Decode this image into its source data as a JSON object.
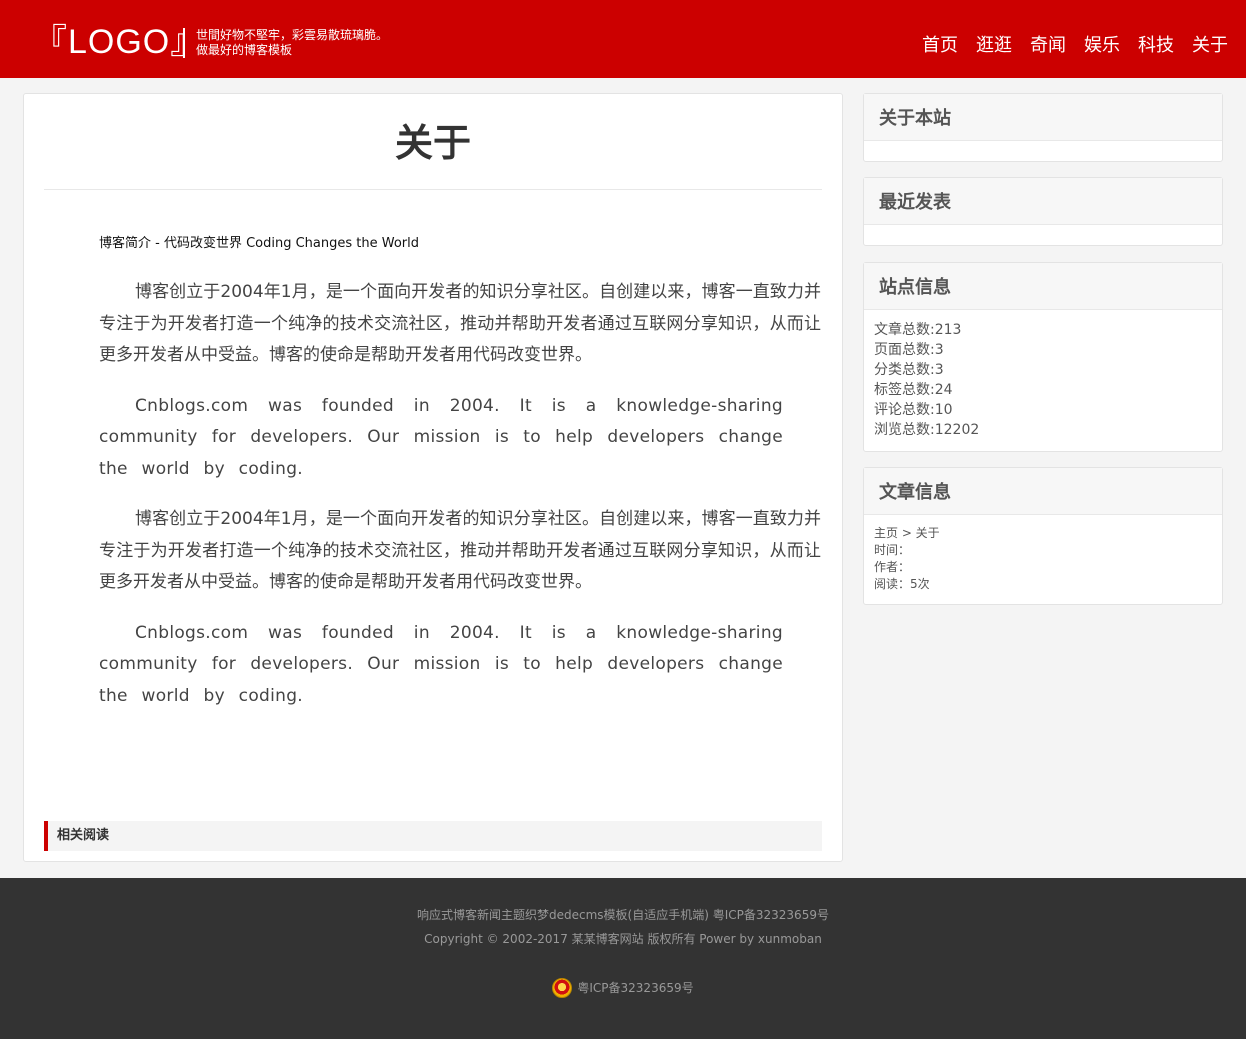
{
  "header": {
    "logo": "『LOGO』",
    "tagline": [
      "世間好物不堅牢，彩雲易散琉璃脆。",
      "做最好的博客模板"
    ],
    "nav": [
      "首页",
      "逛逛",
      "奇闻",
      "娱乐",
      "科技",
      "关于"
    ]
  },
  "article": {
    "title": "关于",
    "intro": "博客简介 - 代码改变世界 Coding Changes the World",
    "paragraphs": [
      "博客创立于2004年1月，是一个面向开发者的知识分享社区。自创建以来，博客一直致力并专注于为开发者打造一个纯净的技术交流社区，推动并帮助开发者通过互联网分享知识，从而让更多开发者从中受益。博客的使命是帮助开发者用代码改变世界。",
      "Cnblogs.com was founded in 2004. It is a knowledge-sharing community for developers. Our mission is to help developers change the world by coding.",
      "博客创立于2004年1月，是一个面向开发者的知识分享社区。自创建以来，博客一直致力并专注于为开发者打造一个纯净的技术交流社区，推动并帮助开发者通过互联网分享知识，从而让更多开发者从中受益。博客的使命是帮助开发者用代码改变世界。",
      "Cnblogs.com was founded in 2004. It is a knowledge-sharing community for developers. Our mission is to help developers change the world by coding."
    ],
    "related_label": "相关阅读"
  },
  "sidebar": {
    "about_title": "关于本站",
    "recent_title": "最近发表",
    "site_info_title": "站点信息",
    "site_info": [
      "文章总数:213",
      "页面总数:3",
      "分类总数:3",
      "标签总数:24",
      "评论总数:10",
      "浏览总数:12202"
    ],
    "post_info_title": "文章信息",
    "post_info": [
      "主页 > 关于",
      "时间：",
      "作者：",
      "阅读：5次"
    ]
  },
  "footer": {
    "line1": "响应式博客新闻主题织梦dedecms模板(自适应手机端) 粤ICP备32323659号",
    "line2": "Copyright © 2002-2017 某某博客网站 版权所有 Power by xunmoban",
    "icp": "粤ICP备32323659号"
  }
}
